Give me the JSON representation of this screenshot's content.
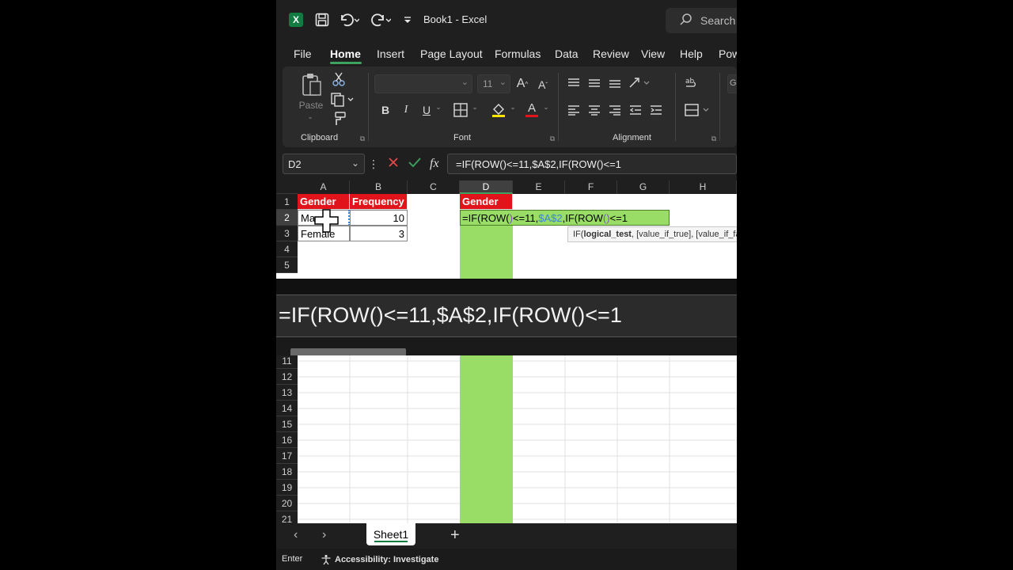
{
  "app": {
    "title": "Book1  -  Excel",
    "search_placeholder": "Search",
    "logo": "X"
  },
  "menu": [
    "File",
    "Home",
    "Insert",
    "Page Layout",
    "Formulas",
    "Data",
    "Review",
    "View",
    "Help",
    "Pow"
  ],
  "ribbon": {
    "clipboard_label": "Clipboard",
    "paste_label": "Paste",
    "font_label": "Font",
    "font_size": "11",
    "alignment_label": "Alignment",
    "number_format_partial": "Ge"
  },
  "formula_bar": {
    "name_box": "D2",
    "formula": "=IF(ROW()<=11,$A$2,IF(ROW()<=1"
  },
  "columns": [
    "A",
    "B",
    "C",
    "D",
    "E",
    "F",
    "G",
    "H"
  ],
  "rows_top": [
    "1",
    "2",
    "3",
    "4",
    "5"
  ],
  "rows_bottom": [
    "11",
    "12",
    "13",
    "14",
    "15",
    "16",
    "17",
    "18",
    "19",
    "20",
    "21"
  ],
  "cells": {
    "A1": "Gender",
    "B1": "Frequency",
    "D1": "Gender",
    "A2": "Ma",
    "B2": "10",
    "A3": "Female",
    "B3": "3"
  },
  "edit_cell": {
    "p1": "=IF(ROW(",
    "p2": ")",
    "p3": "<=11,",
    "p4": "$A$2",
    "p5": ",IF(",
    "p6": "ROW",
    "p7": "()",
    "p8": "<=1"
  },
  "tooltip": {
    "prefix": "IF(",
    "bold": "logical_test",
    "rest": ", [value_if_true], [value_if_false])"
  },
  "zoom_text": "=IF(ROW()<=11,$A$2,IF(ROW()<=1",
  "sheet_tab": "Sheet1",
  "status": {
    "mode": "Enter",
    "accessibility": "Accessibility: Investigate"
  },
  "colors": {
    "header_red": "#e1141c",
    "highlight_green": "#99dd66",
    "excel_green": "#107c41"
  }
}
